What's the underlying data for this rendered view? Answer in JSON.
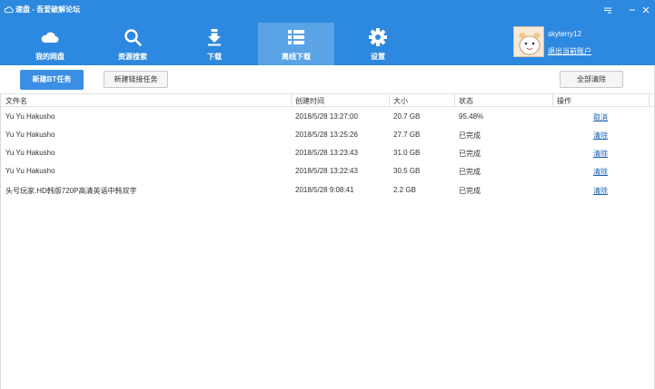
{
  "window": {
    "title": "速盘 - 吾爱破解论坛"
  },
  "nav": {
    "items": [
      {
        "label": "我的网盘",
        "icon": "cloud-icon"
      },
      {
        "label": "资源搜索",
        "icon": "search-icon"
      },
      {
        "label": "下载",
        "icon": "download-icon"
      },
      {
        "label": "离线下载",
        "icon": "list-icon",
        "active": true
      },
      {
        "label": "设置",
        "icon": "gear-icon"
      }
    ]
  },
  "user": {
    "name": "skyterry12",
    "logout_label": "退出当前账户"
  },
  "toolbar": {
    "new_bt_task": "新建BT任务",
    "new_link_task": "新建链接任务",
    "clear_all": "全部清除"
  },
  "table": {
    "headers": {
      "name": "文件名",
      "created": "创建时间",
      "size": "大小",
      "status": "状态",
      "action": "操作"
    },
    "rows": [
      {
        "name": "Yu Yu Hakusho",
        "created": "2018/5/28 13:27:00",
        "size": "20.7 GB",
        "status": "95.48%",
        "action": "取消"
      },
      {
        "name": "Yu Yu Hakusho",
        "created": "2018/5/28 13:25:26",
        "size": "27.7 GB",
        "status": "已完成",
        "action": "清除"
      },
      {
        "name": "Yu Yu Hakusho",
        "created": "2018/5/28 13:23:43",
        "size": "31.0 GB",
        "status": "已完成",
        "action": "清除"
      },
      {
        "name": "Yu Yu Hakusho",
        "created": "2018/5/28 13:22:43",
        "size": "30.5 GB",
        "status": "已完成",
        "action": "清除"
      },
      {
        "name": "头号玩家.HD韩版720P高清英语中韩双字",
        "created": "2018/5/28 9:08:41",
        "size": "2.2 GB",
        "status": "已完成",
        "action": "清除"
      }
    ]
  },
  "colors": {
    "header_bg": "#2d88df",
    "nav_active_bg": "#5aa3e6",
    "primary_button": "#3a8ee6",
    "link": "#1a5fb4"
  }
}
